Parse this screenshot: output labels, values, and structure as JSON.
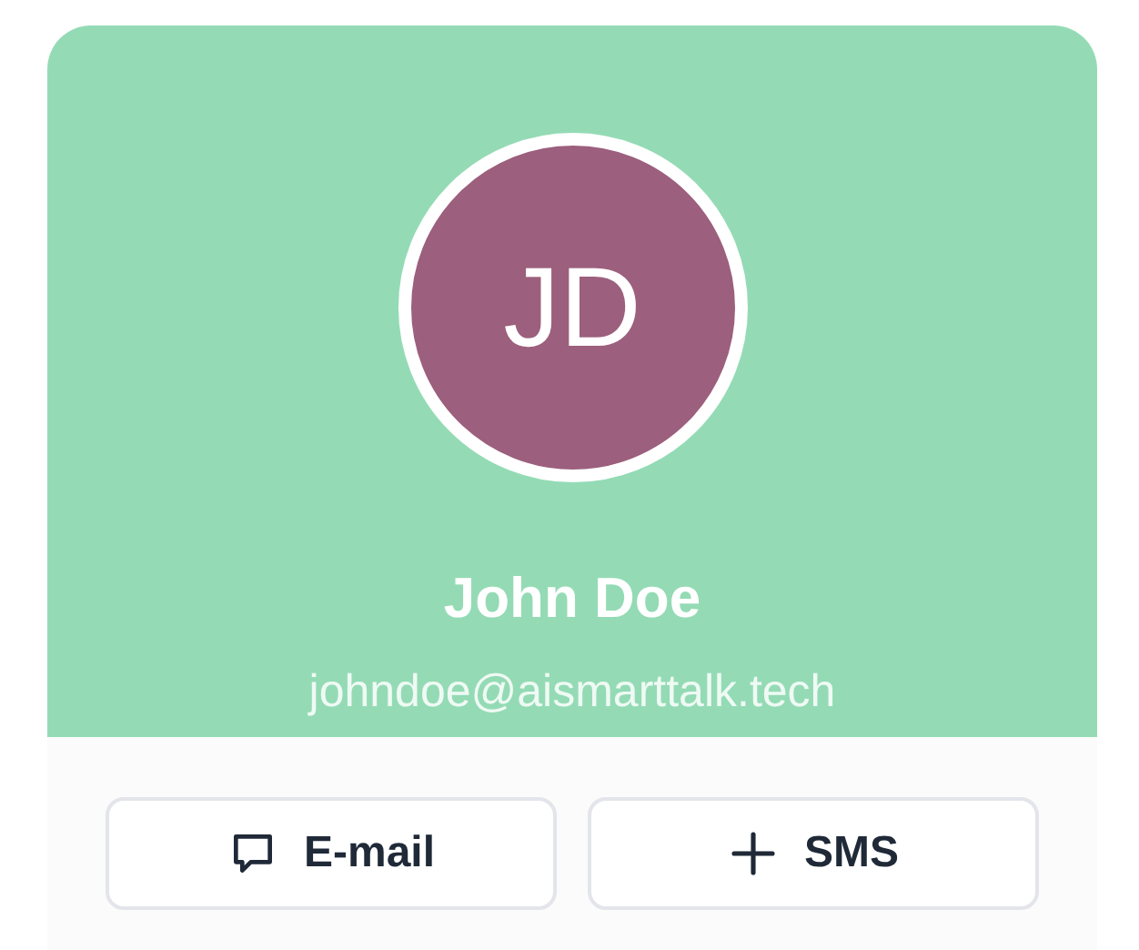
{
  "profile": {
    "initials": "JD",
    "name": "John Doe",
    "email": "johndoe@aismarttalk.tech"
  },
  "actions": [
    {
      "kind": "email",
      "label": "E-mail"
    },
    {
      "kind": "sms",
      "label": "SMS"
    }
  ]
}
